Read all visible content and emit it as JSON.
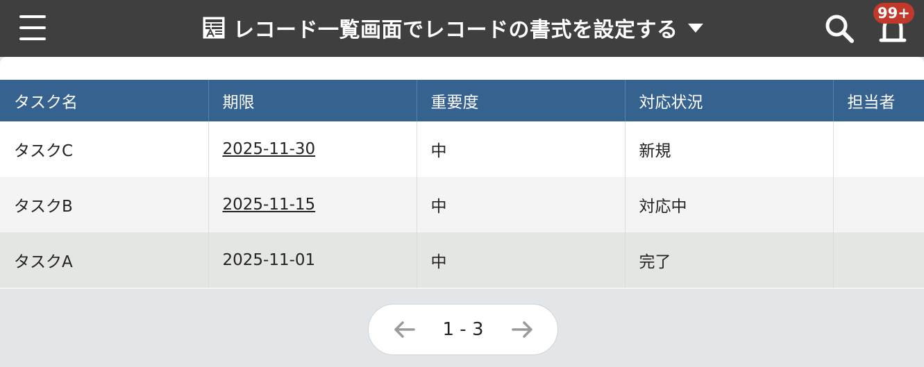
{
  "header": {
    "title": "レコード一覧画面でレコードの書式を設定する",
    "badge": "99+",
    "icons": [
      "menu-icon",
      "app-icon",
      "chevron-down-icon",
      "search-icon",
      "bell-icon"
    ]
  },
  "table": {
    "columns": [
      "タスク名",
      "期限",
      "重要度",
      "対応状況",
      "担当者"
    ],
    "rows": [
      {
        "task": "タスクC",
        "due": "2025-11-30",
        "priority": "中",
        "status": "新規",
        "assignee": ""
      },
      {
        "task": "タスクB",
        "due": "2025-11-15",
        "priority": "中",
        "status": "対応中",
        "assignee": ""
      },
      {
        "task": "タスクA",
        "due": "2025-11-01",
        "priority": "中",
        "status": "完了",
        "assignee": ""
      }
    ]
  },
  "pager": {
    "range": "1 - 3",
    "icons": [
      "arrow-left-icon",
      "arrow-right-icon"
    ]
  },
  "colors": {
    "topbar": "#3f3f3f",
    "table_header": "#366290",
    "badge": "#c0392b",
    "page_background": "#e3e6e8"
  }
}
